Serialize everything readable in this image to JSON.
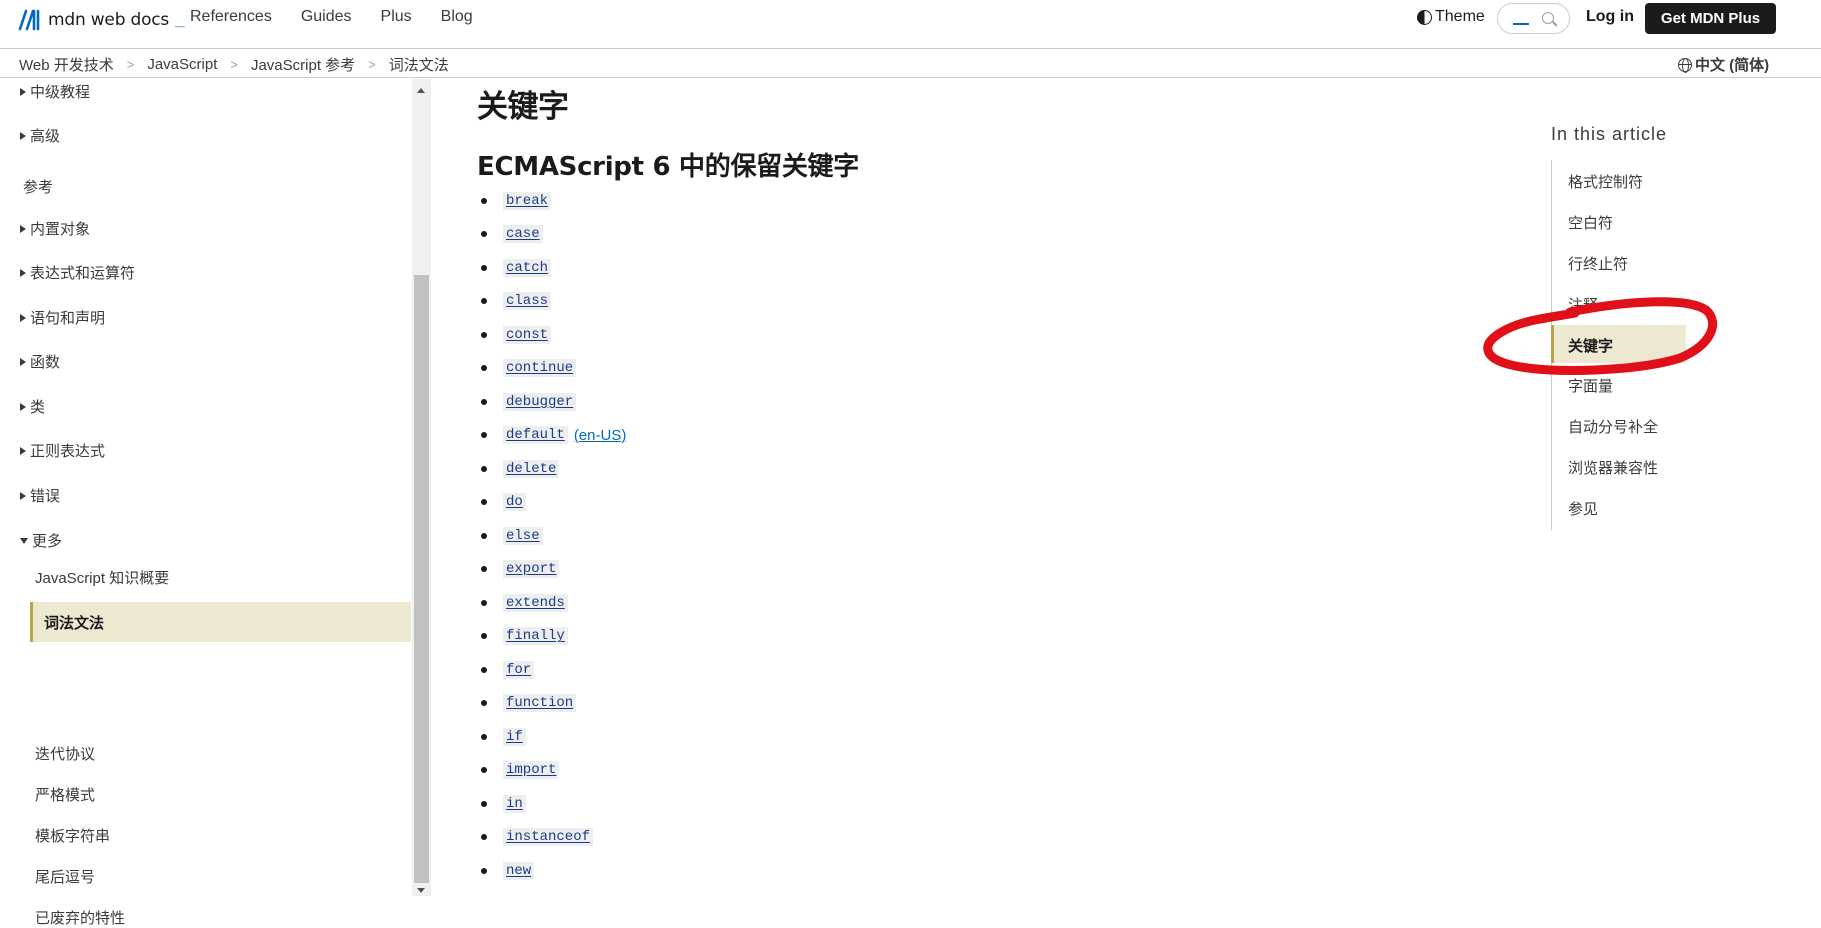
{
  "header": {
    "logo_text": "mdn web docs",
    "logo_underscore": "_",
    "nav": [
      "References",
      "Guides",
      "Plus",
      "Blog"
    ],
    "theme_label": "Theme",
    "search_placeholder": "",
    "login_label": "Log in",
    "cta_label": "Get MDN Plus"
  },
  "breadcrumb": {
    "items": [
      "Web 开发技术",
      "JavaScript",
      "JavaScript 参考",
      "词法文法"
    ],
    "language": "中文 (简体)"
  },
  "sidebar": {
    "items": [
      {
        "label": "中级教程",
        "type": "collapsed"
      },
      {
        "label": "高级",
        "type": "collapsed"
      },
      {
        "label": "参考",
        "type": "heading"
      },
      {
        "label": "内置对象",
        "type": "collapsed"
      },
      {
        "label": "表达式和运算符",
        "type": "collapsed"
      },
      {
        "label": "语句和声明",
        "type": "collapsed"
      },
      {
        "label": "函数",
        "type": "collapsed"
      },
      {
        "label": "类",
        "type": "collapsed"
      },
      {
        "label": "正则表达式",
        "type": "collapsed"
      },
      {
        "label": "错误",
        "type": "collapsed"
      },
      {
        "label": "更多",
        "type": "expanded"
      }
    ],
    "sub_items": [
      "JavaScript 知识概要",
      "词法文法",
      "迭代协议",
      "严格模式",
      "模板字符串",
      "尾后逗号",
      "已废弃的特性"
    ],
    "active_sub": "词法文法"
  },
  "main": {
    "heading": "关键字",
    "subheading": "ECMAScript 6 中的保留关键字",
    "keywords": [
      "break",
      "case",
      "catch",
      "class",
      "const",
      "continue",
      "debugger",
      "default",
      "delete",
      "do",
      "else",
      "export",
      "extends",
      "finally",
      "for",
      "function",
      "if",
      "import",
      "in",
      "instanceof",
      "new"
    ],
    "default_note": "(en-US)"
  },
  "toc": {
    "title": "In this article",
    "items": [
      "格式控制符",
      "空白符",
      "行终止符",
      "注释",
      "关键字",
      "字面量",
      "自动分号补全",
      "浏览器兼容性",
      "参见"
    ],
    "active": "关键字"
  },
  "colors": {
    "accent": "#0069c2",
    "active_bg": "#ede8d0",
    "active_border": "#b8a34a",
    "annotation": "#e0101a"
  }
}
